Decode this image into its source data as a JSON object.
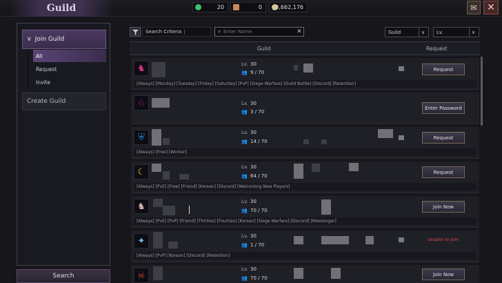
{
  "window": {
    "title": "Guild"
  },
  "currencies": [
    {
      "icon": "green-gem-icon",
      "value": "20",
      "color": "#3fbf6a"
    },
    {
      "icon": "feather-icon",
      "value": "0",
      "color": "#c98a5a"
    },
    {
      "icon": "silver-coin-icon",
      "value": "3,662,176",
      "color": "#d0c89a"
    }
  ],
  "sidebar": {
    "join_guild": "Join Guild",
    "sub_items": [
      "All",
      "Request",
      "Invite"
    ],
    "create_guild": "Create Guild",
    "search_button": "Search"
  },
  "filters": {
    "search_criteria": "Search Criteria",
    "name_placeholder": "Enter Name",
    "dropdown1": "Guild",
    "dropdown2": "Lv."
  },
  "table": {
    "headers": {
      "guild": "Guild",
      "request": "Request"
    },
    "rows": [
      {
        "emblem": "dragon-emblem-icon",
        "emblem_color": "#d0307a",
        "lv_label": "Lv.",
        "level": "30",
        "members": "9 / 70",
        "tags": "[Always] [Monday] [Tuesday] [Friday] [Saturday] [PvP] [Siege Warfare] [Guild Battle] [Discord] [Retention]",
        "action": "Request"
      },
      {
        "emblem": "pegasus-emblem-icon",
        "emblem_color": "#e030c0",
        "lv_label": "Lv.",
        "level": "30",
        "members": "3 / 70",
        "tags": "",
        "action": "Enter Password"
      },
      {
        "emblem": "shield-emblem-icon",
        "emblem_color": "#3080d0",
        "lv_label": "Lv.",
        "level": "30",
        "members": "14 / 70",
        "tags": "[Always] [Free] [Worker]",
        "action": "Request"
      },
      {
        "emblem": "crescent-emblem-icon",
        "emblem_color": "#e0c030",
        "lv_label": "Lv.",
        "level": "30",
        "members": "64 / 70",
        "tags": "[Always] [PvE] [Free] [Friend] [Korean] [Discord] [Welcoming New Players]",
        "action": "Request"
      },
      {
        "emblem": "unicorn-emblem-icon",
        "emblem_color": "#d8b0b0",
        "lv_label": "Lv.",
        "level": "30",
        "members": "70 / 70",
        "tags": "[Always] [PvE] [PvP] [Friend] [Thirties] [Fourties] [Korean] [Siege Warfare] [Discord] [Messenger]",
        "action": "Join Now"
      },
      {
        "emblem": "star-emblem-icon",
        "emblem_color": "#70b8e8",
        "lv_label": "Lv.",
        "level": "30",
        "members": "1 / 70",
        "tags": "[Always] [PvP] [Korean] [Discord] [Retention]",
        "action": "Unable to join"
      },
      {
        "emblem": "skull-emblem-icon",
        "emblem_color": "#c04030",
        "lv_label": "Lv.",
        "level": "30",
        "members": "70 / 70",
        "tags": "",
        "action": "Join Now"
      }
    ]
  }
}
